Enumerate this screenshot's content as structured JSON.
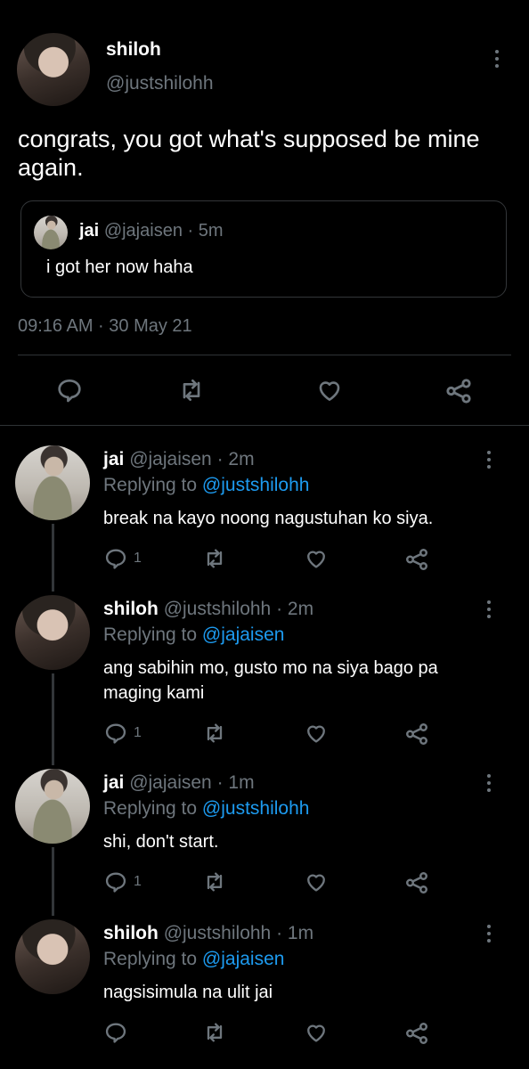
{
  "main_tweet": {
    "display_name": "shiloh",
    "handle": "@justshilohh",
    "text": "congrats, you got what's supposed be mine again.",
    "quote": {
      "display_name": "jai",
      "handle": "@jajaisen",
      "separator": "·",
      "time": "5m",
      "text": "i got her now haha"
    },
    "timestamp": "09:16 AM · 30 May 21",
    "actions": [
      "reply-icon",
      "retweet-icon",
      "like-icon",
      "share-icon"
    ]
  },
  "replies": [
    {
      "display_name": "jai",
      "handle": "@jajaisen",
      "time": "· 2m",
      "replying_prefix": "Replying to",
      "replying_to": "@justshilohh",
      "text_lines": [
        "break na kayo noong nagustuhan ko siya.",
        ""
      ],
      "reply_count": "1",
      "avatar": "jai"
    },
    {
      "display_name": "shiloh",
      "handle": "@justshilohh",
      "time": "· 2m",
      "replying_prefix": "Replying to",
      "replying_to": "@jajaisen",
      "text_lines": [
        "ang sabihin mo, gusto mo na siya bago pa",
        "maging kami"
      ],
      "reply_count": "1",
      "avatar": "shiloh"
    },
    {
      "display_name": "jai",
      "handle": "@jajaisen",
      "time": "· 1m",
      "replying_prefix": "Replying to",
      "replying_to": "@justshilohh",
      "text_lines": [
        "shi, don't start.",
        ""
      ],
      "reply_count": "1",
      "avatar": "jai"
    },
    {
      "display_name": "shiloh",
      "handle": "@justshilohh",
      "time": "· 1m",
      "replying_prefix": "Replying to",
      "replying_to": "@jajaisen",
      "text_lines": [
        "nagsisimula na ulit jai",
        ""
      ],
      "reply_count": "",
      "avatar": "shiloh"
    }
  ]
}
